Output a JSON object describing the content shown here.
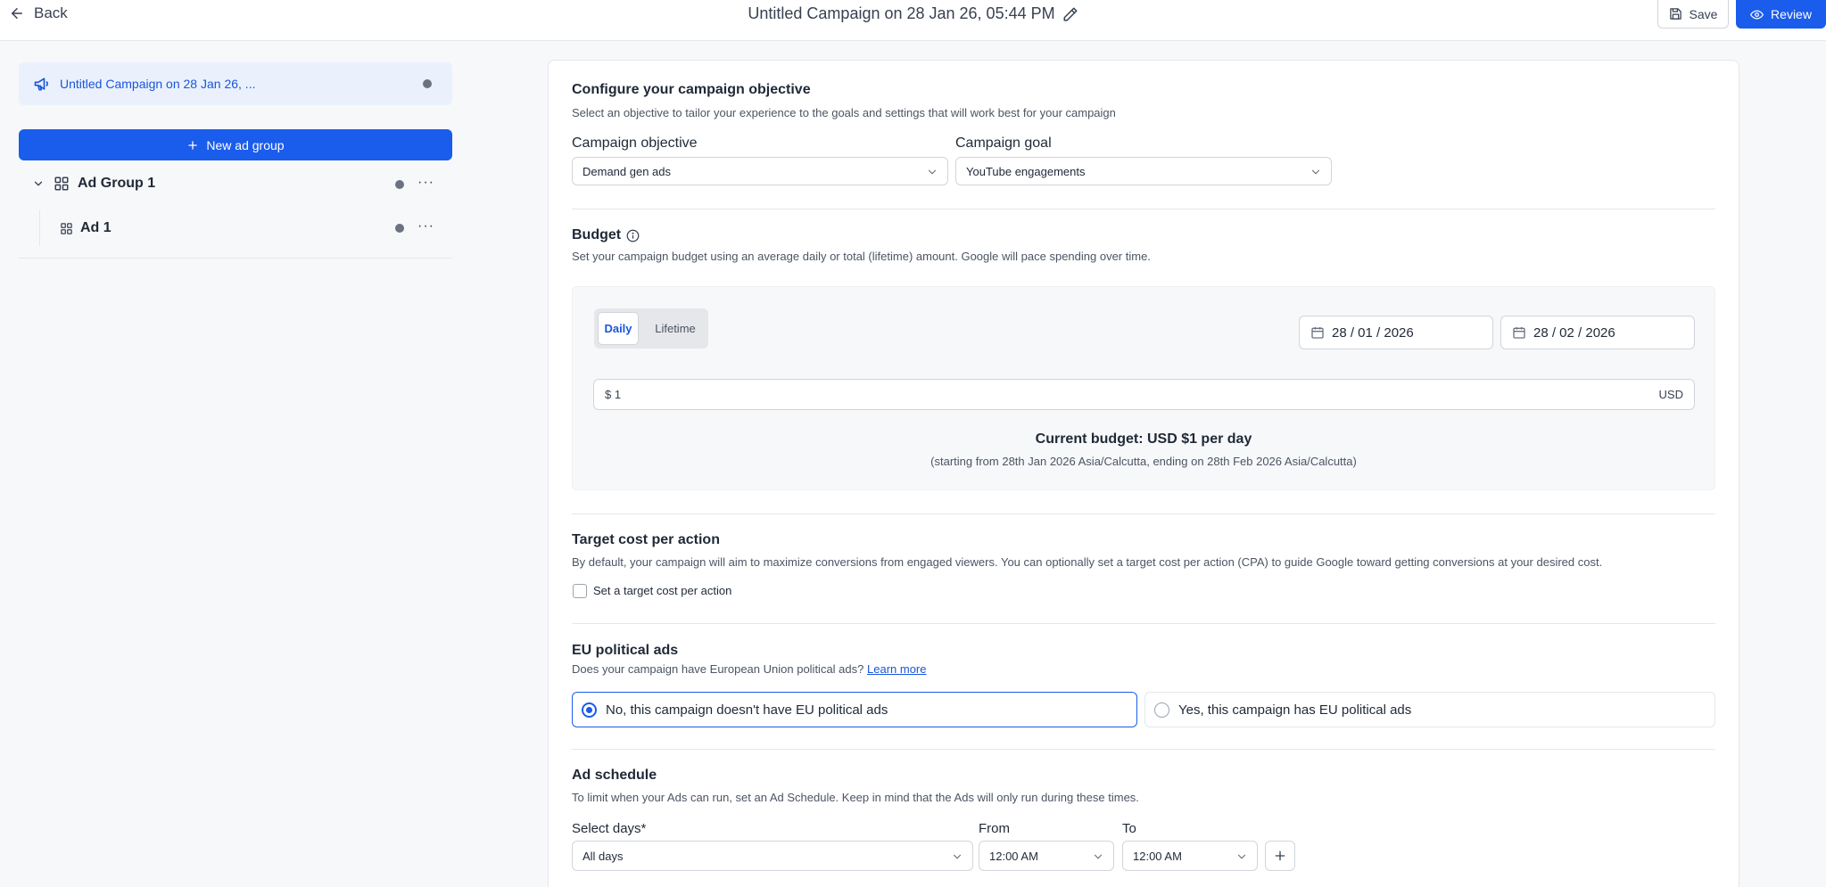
{
  "header": {
    "back_label": "Back",
    "title": "Untitled Campaign on 28 Jan 26, 05:44 PM",
    "save_label": "Save",
    "review_label": "Review"
  },
  "sidebar": {
    "campaign_label": "Untitled Campaign on 28 Jan 26, ...",
    "new_ad_group_label": "New ad group",
    "ad_group": {
      "name": "Ad Group 1",
      "more": "···"
    },
    "ad": {
      "name": "Ad 1",
      "more": "···"
    }
  },
  "objective": {
    "heading": "Configure your campaign objective",
    "description": "Select an objective to tailor your experience to the goals and settings that will work best for your campaign",
    "objective_label": "Campaign objective",
    "objective_value": "Demand gen ads",
    "goal_label": "Campaign goal",
    "goal_value": "YouTube engagements"
  },
  "budget": {
    "heading": "Budget",
    "description": "Set your campaign budget using an average daily or total (lifetime) amount. Google will pace spending over time.",
    "tab_daily": "Daily",
    "tab_lifetime": "Lifetime",
    "selected_tab": "Daily",
    "start_date": "28 / 01 / 2026",
    "end_date": "28 / 02 / 2026",
    "amount": "$ 1",
    "currency": "USD",
    "current_budget": "Current budget:  USD $1 per day",
    "range_text": "(starting from 28th Jan 2026 Asia/Calcutta, ending on 28th Feb 2026 Asia/Calcutta)"
  },
  "cpa": {
    "heading": "Target cost per action",
    "description": "By default, your campaign will aim to maximize conversions from engaged viewers. You can optionally set a target cost per action (CPA) to guide Google toward getting conversions at your desired cost.",
    "checkbox_label": "Set a target cost per action",
    "checked": false
  },
  "eu": {
    "heading": "EU political ads",
    "question": "Does your campaign have European Union political ads?",
    "learn_more": "Learn more",
    "option_no": "No, this campaign doesn't have EU political ads",
    "option_yes": "Yes, this campaign has EU political ads",
    "selected": "no"
  },
  "schedule": {
    "heading": "Ad schedule",
    "description": "To limit when your Ads can run, set an Ad Schedule. Keep in mind that the Ads will only run during these times.",
    "days_label": "Select days*",
    "days_value": "All days",
    "from_label": "From",
    "from_value": "12:00 AM",
    "to_label": "To",
    "to_value": "12:00 AM"
  },
  "colors": {
    "accent": "#1a5ceb",
    "sidebar_selected_bg": "#eaf1fd"
  }
}
